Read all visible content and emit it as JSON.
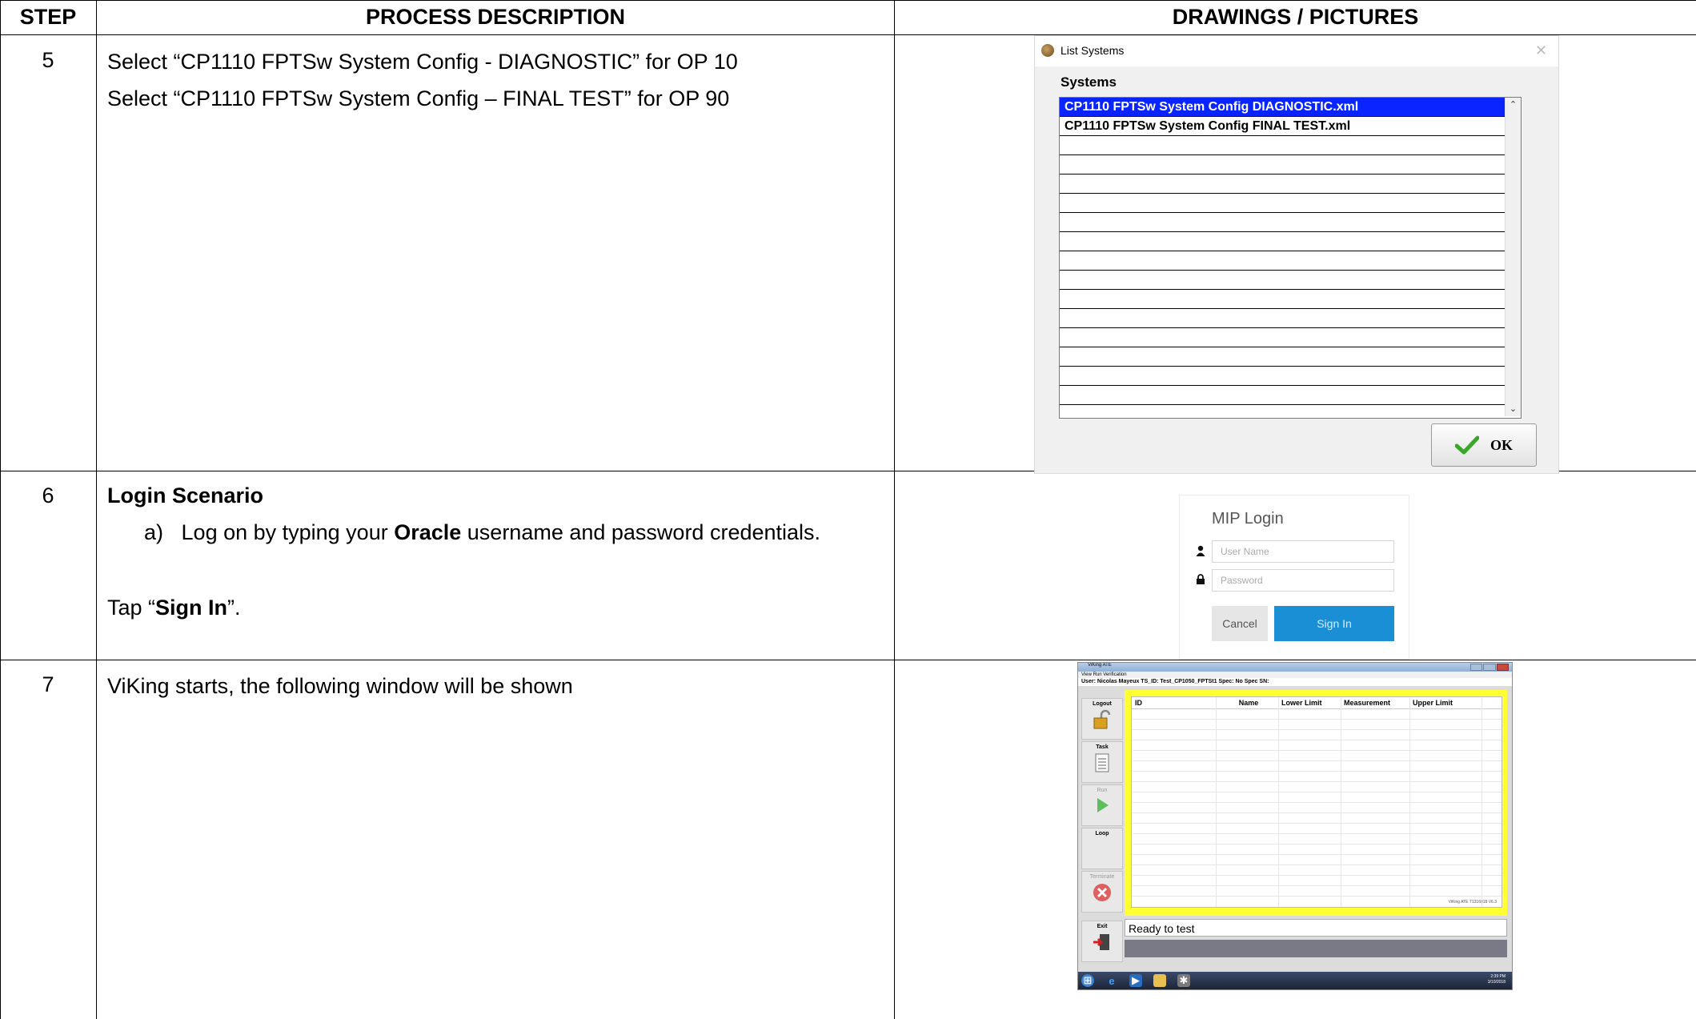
{
  "table": {
    "headers": {
      "step": "STEP",
      "process": "PROCESS DESCRIPTION",
      "drawings": "DRAWINGS / PICTURES"
    },
    "rows": [
      {
        "step": "5",
        "lines": [
          "Select “CP1110 FPTSw System Config - DIAGNOSTIC” for OP 10",
          "Select “CP1110 FPTSw System Config – FINAL TEST” for OP 90"
        ]
      },
      {
        "step": "6",
        "title": "Login Scenario",
        "item_prefix": "a)",
        "item_text_before": "Log on by typing your ",
        "item_bold": "Oracle",
        "item_text_after": " username and password credentials.",
        "tap_before": "Tap “",
        "tap_bold": "Sign In",
        "tap_after": "”."
      },
      {
        "step": "7",
        "lines": [
          "ViKing starts, the following window will be shown"
        ]
      }
    ]
  },
  "list_systems_dialog": {
    "title": "List Systems",
    "close_glyph": "✕",
    "section_label": "Systems",
    "items": [
      "CP1110 FPTSw System Config DIAGNOSTIC.xml",
      "CP1110 FPTSw System Config FINAL TEST.xml",
      "",
      "",
      "",
      "",
      "",
      "",
      "",
      "",
      "",
      "",
      "",
      "",
      "",
      ""
    ],
    "selected_index": 0,
    "ok_label": "OK",
    "ok_icon": "checkmark-icon"
  },
  "mip_login": {
    "title": "MIP Login",
    "username_placeholder": "User Name",
    "password_placeholder": "Password",
    "cancel_label": "Cancel",
    "signin_label": "Sign In"
  },
  "viking_window": {
    "title": "ViKing ATE",
    "menu": "View   Run   Verification",
    "user_line": "User: Nicolas Mayeux    TS_ID: Test_CP1050_FPTSt1    Spec: No Spec    SN:",
    "side_buttons": [
      {
        "label": "Logout",
        "icon": "unlock-icon",
        "enabled": true
      },
      {
        "label": "Task",
        "icon": "clipboard-icon",
        "enabled": true
      },
      {
        "label": "Run",
        "icon": "play-icon",
        "enabled": false
      },
      {
        "label": "Loop",
        "icon": "loop-icon",
        "enabled": true
      },
      {
        "label": "Terminate",
        "icon": "stop-icon",
        "enabled": false
      },
      {
        "label": "Exit",
        "icon": "exit-icon",
        "enabled": true
      }
    ],
    "columns": [
      "ID",
      "Name",
      "Lower Limit",
      "Measurement",
      "Upper Limit"
    ],
    "version": "ViKing ATE T1316018 V6.3",
    "status": "Ready to test",
    "clock_time": "2:39 PM",
    "clock_date": "3/10/2018"
  }
}
